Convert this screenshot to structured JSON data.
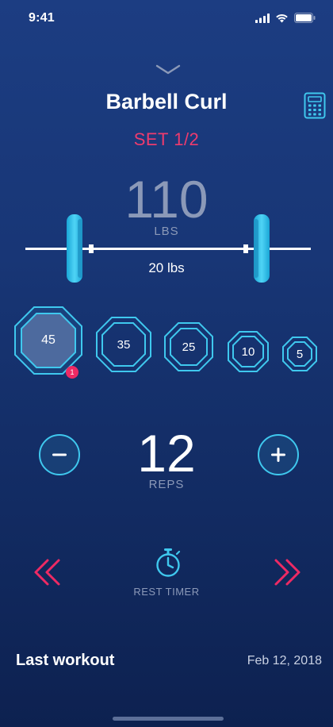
{
  "status": {
    "time": "9:41"
  },
  "exercise": {
    "title": "Barbell Curl",
    "set_label": "SET 1/2"
  },
  "weight": {
    "value": "110",
    "unit": "LBS",
    "bar_weight": "20 lbs"
  },
  "plates": [
    {
      "label": "45",
      "selected": true,
      "badge": "1"
    },
    {
      "label": "35",
      "selected": false
    },
    {
      "label": "25",
      "selected": false
    },
    {
      "label": "10",
      "selected": false
    },
    {
      "label": "5",
      "selected": false
    }
  ],
  "reps": {
    "value": "12",
    "label": "REPS",
    "decrement_icon": "minus-icon",
    "increment_icon": "plus-icon"
  },
  "rest_timer": {
    "label": "REST TIMER",
    "icon": "stopwatch-icon"
  },
  "navigation": {
    "prev_icon": "double-chevron-left-icon",
    "next_icon": "double-chevron-right-icon",
    "collapse_icon": "chevron-down-icon"
  },
  "last_workout": {
    "title": "Last workout",
    "date": "Feb 12, 2018"
  },
  "colors": {
    "accent_cyan": "#3fc8ee",
    "accent_pink": "#ee3b6e",
    "muted_text": "#8b99b8"
  }
}
